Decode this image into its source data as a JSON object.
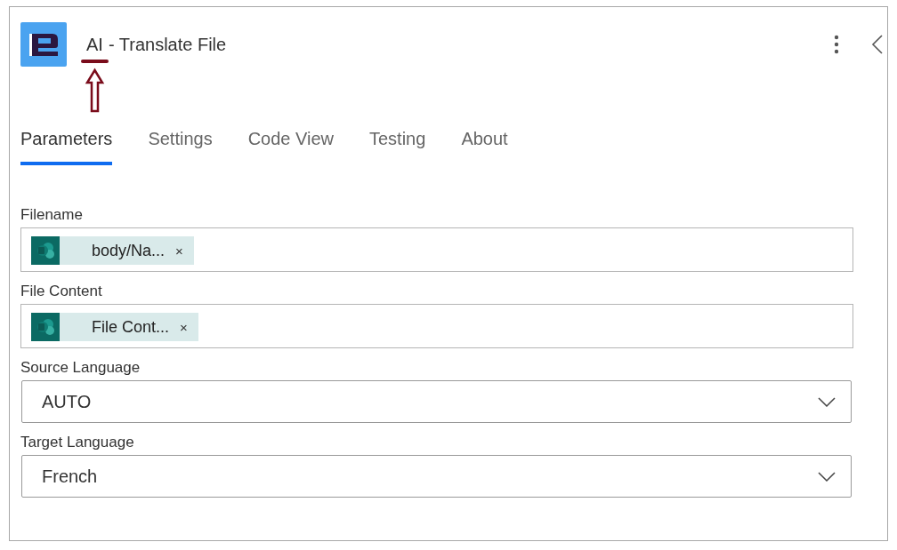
{
  "header": {
    "title_prefix": "AI",
    "title_rest": "- Translate File"
  },
  "tabs": [
    {
      "label": "Parameters",
      "selected": true
    },
    {
      "label": "Settings",
      "selected": false
    },
    {
      "label": "Code View",
      "selected": false
    },
    {
      "label": "Testing",
      "selected": false
    },
    {
      "label": "About",
      "selected": false
    }
  ],
  "fields": [
    {
      "kind": "token",
      "label": "Filename",
      "token": "body/Na...",
      "remove": "×"
    },
    {
      "kind": "token",
      "label": "File Content",
      "token": "File Cont...",
      "remove": "×"
    },
    {
      "kind": "dropdown",
      "label": "Source Language",
      "value": "AUTO"
    },
    {
      "kind": "dropdown",
      "label": "Target Language",
      "value": "French"
    }
  ]
}
